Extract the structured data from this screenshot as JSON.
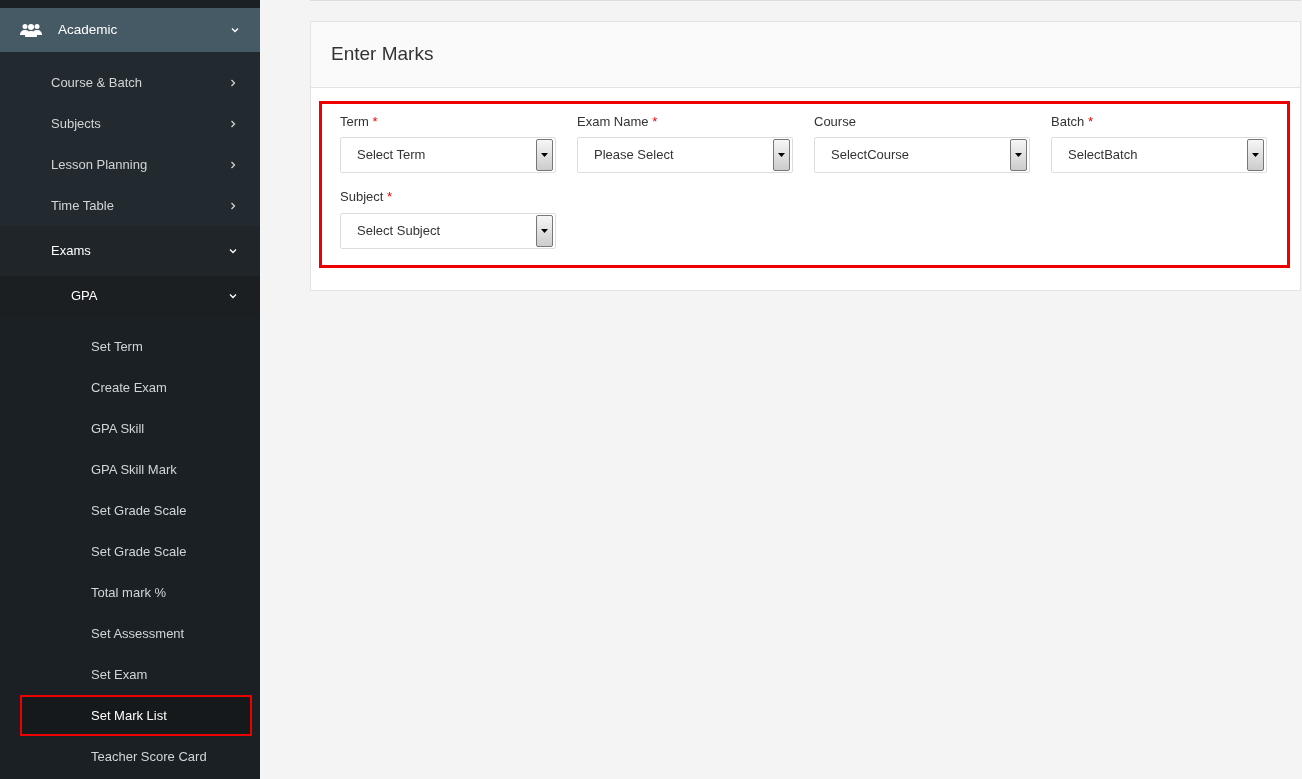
{
  "sidebar": {
    "section": {
      "label": "Academic",
      "expanded": true
    },
    "items": [
      {
        "label": "Course & Batch",
        "expanded": false
      },
      {
        "label": "Subjects",
        "expanded": false
      },
      {
        "label": "Lesson Planning",
        "expanded": false
      },
      {
        "label": "Time Table",
        "expanded": false
      },
      {
        "label": "Exams",
        "expanded": true,
        "children": [
          {
            "label": "GPA",
            "expanded": true,
            "children": [
              {
                "label": "Set Term",
                "selected": false
              },
              {
                "label": "Create Exam",
                "selected": false
              },
              {
                "label": "GPA Skill",
                "selected": false
              },
              {
                "label": "GPA Skill Mark",
                "selected": false
              },
              {
                "label": "Set Grade Scale",
                "selected": false
              },
              {
                "label": "Set Grade Scale",
                "selected": false
              },
              {
                "label": "Total mark %",
                "selected": false
              },
              {
                "label": "Set Assessment",
                "selected": false
              },
              {
                "label": "Set Exam",
                "selected": false
              },
              {
                "label": "Set Mark List",
                "selected": true
              },
              {
                "label": "Teacher Score Card",
                "selected": false
              }
            ]
          }
        ]
      }
    ]
  },
  "panel": {
    "title": "Enter Marks",
    "highlighted": true,
    "fields": [
      {
        "label": "Term",
        "required_mark": "*",
        "value": "Select Term"
      },
      {
        "label": "Exam Name",
        "required_mark": "*",
        "value": "Please Select"
      },
      {
        "label": "Course",
        "value": "SelectCourse"
      },
      {
        "label": "Batch",
        "required_mark": "*",
        "value": "SelectBatch"
      },
      {
        "label": "Subject",
        "required_mark": "*",
        "value": "Select Subject"
      }
    ]
  }
}
